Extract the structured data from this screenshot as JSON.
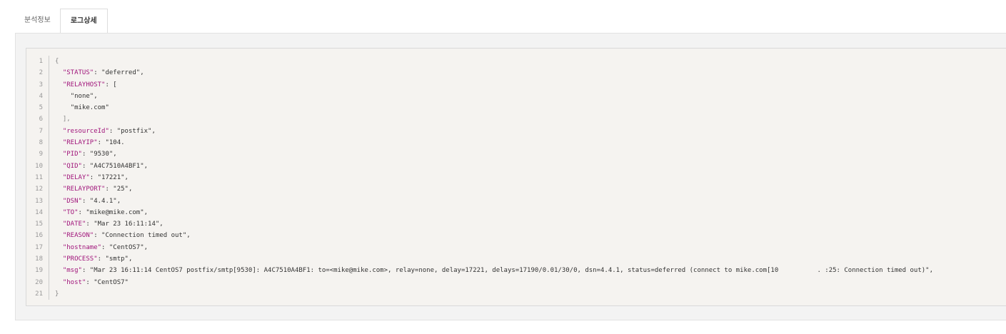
{
  "tabs": [
    {
      "label": "분석정보",
      "active": false
    },
    {
      "label": "로그상세",
      "active": true
    }
  ],
  "code_lines": [
    {
      "n": "1",
      "indent": "",
      "key": "",
      "rest": "{",
      "brace": true
    },
    {
      "n": "2",
      "indent": "  ",
      "key": "\"STATUS\"",
      "rest": ": \"deferred\","
    },
    {
      "n": "3",
      "indent": "  ",
      "key": "\"RELAYHOST\"",
      "rest": ": ["
    },
    {
      "n": "4",
      "indent": "    ",
      "key": "",
      "rest": "\"none\","
    },
    {
      "n": "5",
      "indent": "    ",
      "key": "",
      "rest": "\"mike.com\""
    },
    {
      "n": "6",
      "indent": "  ",
      "key": "",
      "rest": "],",
      "brace": true
    },
    {
      "n": "7",
      "indent": "  ",
      "key": "\"resourceId\"",
      "rest": ": \"postfix\","
    },
    {
      "n": "8",
      "indent": "  ",
      "key": "\"RELAYIP\"",
      "rest": ": \"104."
    },
    {
      "n": "9",
      "indent": "  ",
      "key": "\"PID\"",
      "rest": ": \"9530\","
    },
    {
      "n": "10",
      "indent": "  ",
      "key": "\"QID\"",
      "rest": ": \"A4C7510A4BF1\","
    },
    {
      "n": "11",
      "indent": "  ",
      "key": "\"DELAY\"",
      "rest": ": \"17221\","
    },
    {
      "n": "12",
      "indent": "  ",
      "key": "\"RELAYPORT\"",
      "rest": ": \"25\","
    },
    {
      "n": "13",
      "indent": "  ",
      "key": "\"DSN\"",
      "rest": ": \"4.4.1\","
    },
    {
      "n": "14",
      "indent": "  ",
      "key": "\"TO\"",
      "rest": ": \"mike@mike.com\","
    },
    {
      "n": "15",
      "indent": "  ",
      "key": "\"DATE\"",
      "rest": ": \"Mar 23 16:11:14\","
    },
    {
      "n": "16",
      "indent": "  ",
      "key": "\"REASON\"",
      "rest": ": \"Connection timed out\","
    },
    {
      "n": "17",
      "indent": "  ",
      "key": "\"hostname\"",
      "rest": ": \"CentOS7\","
    },
    {
      "n": "18",
      "indent": "  ",
      "key": "\"PROCESS\"",
      "rest": ": \"smtp\","
    },
    {
      "n": "19",
      "indent": "  ",
      "key": "\"msg\"",
      "rest": ": \"Mar 23 16:11:14 CentOS7 postfix/smtp[9530]: A4C7510A4BF1: to=<mike@mike.com>, relay=none, delay=17221, delays=17190/0.01/30/0, dsn=4.4.1, status=deferred (connect to mike.com[10          . :25: Connection timed out)\","
    },
    {
      "n": "20",
      "indent": "  ",
      "key": "\"host\"",
      "rest": ": \"CentOS7\""
    },
    {
      "n": "21",
      "indent": "",
      "key": "",
      "rest": "}",
      "brace": true
    }
  ]
}
